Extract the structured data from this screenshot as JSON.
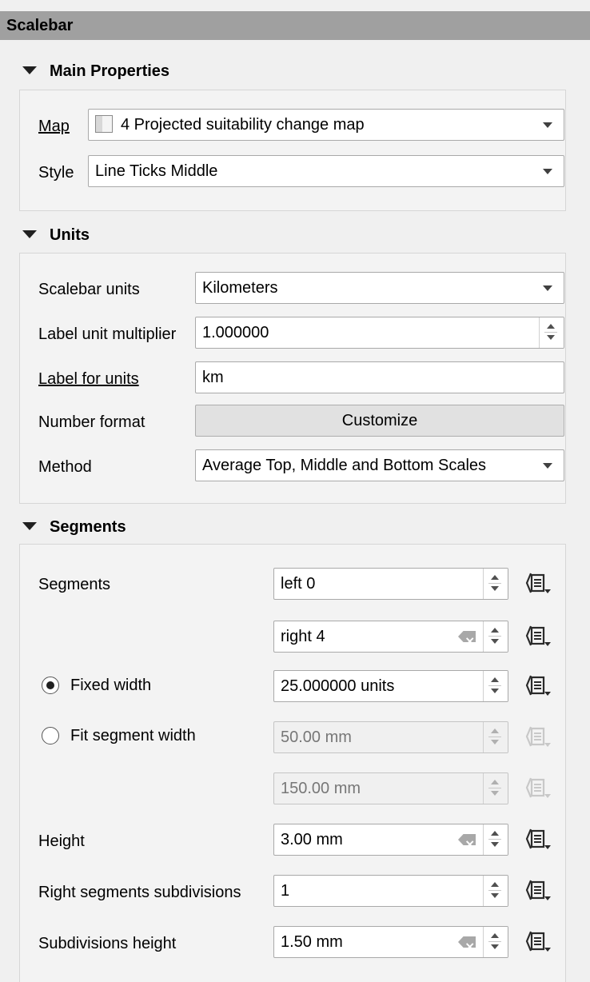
{
  "panel_title": "Scalebar",
  "sections": {
    "main": {
      "header": "Main Properties",
      "map_label": "Map",
      "map_value": "4 Projected suitability change map",
      "style_label": "Style",
      "style_value": "Line Ticks Middle"
    },
    "units": {
      "header": "Units",
      "scalebar_units_label": "Scalebar units",
      "scalebar_units_value": "Kilometers",
      "multiplier_label": "Label unit multiplier",
      "multiplier_value": "1.000000",
      "label_for_units_label": "Label for units",
      "label_for_units_value": "km",
      "number_format_label": "Number format",
      "customize_button": "Customize",
      "method_label": "Method",
      "method_value": "Average Top, Middle and Bottom Scales"
    },
    "segments": {
      "header": "Segments",
      "segments_label": "Segments",
      "left_value": "left 0",
      "right_value": "right 4",
      "fixed_width_label": "Fixed width",
      "fixed_width_value": "25.000000 units",
      "fit_segment_label": "Fit segment width",
      "fit_min_value": "50.00 mm",
      "fit_max_value": "150.00 mm",
      "height_label": "Height",
      "height_value": "3.00 mm",
      "right_subdiv_label": "Right segments subdivisions",
      "right_subdiv_value": "1",
      "subdiv_height_label": "Subdivisions height",
      "subdiv_height_value": "1.50 mm"
    }
  },
  "icons": {
    "collapse": "triangle-down-icon",
    "data_defined": "data-defined-override-icon",
    "clear": "clear-icon",
    "layer": "map-layer-icon"
  }
}
